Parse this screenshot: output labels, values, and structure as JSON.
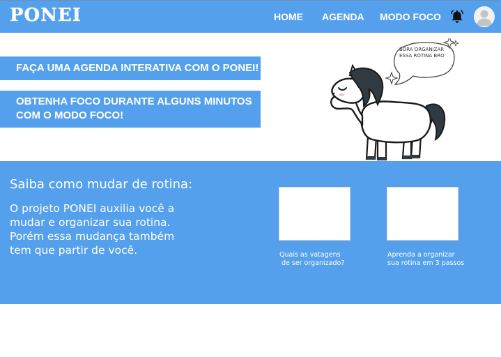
{
  "header": {
    "brand": "PONEI",
    "nav": [
      {
        "label": "HOME"
      },
      {
        "label": "AGENDA"
      },
      {
        "label": "MODO FOCO"
      }
    ],
    "bell_icon": "bell-icon",
    "avatar_icon": "user-avatar-icon"
  },
  "promos": [
    {
      "text": "FAÇA UMA AGENDA INTERATIVA COM O PONEI!"
    },
    {
      "text": "OBTENHA FOCO DURANTE ALGUNS MINUTOS COM O MODO FOCO!"
    }
  ],
  "mascot": {
    "speech": "BORA ORGANIZAR ESSA ROTINA BRO"
  },
  "info": {
    "title": "Saiba como mudar de rotina:",
    "body": "O projeto PONEI auxilia você a mudar e organizar sua rotina. Porém essa mudança também tem que partir de você.",
    "cards": [
      {
        "caption": "Quais as vatagens\n de ser organizado?"
      },
      {
        "caption": "Aprenda a organizar\nsua rotina em 3 passos"
      }
    ]
  },
  "colors": {
    "accent": "#55a0ec",
    "text_on_accent": "#ffffff",
    "background": "#ffffff"
  }
}
